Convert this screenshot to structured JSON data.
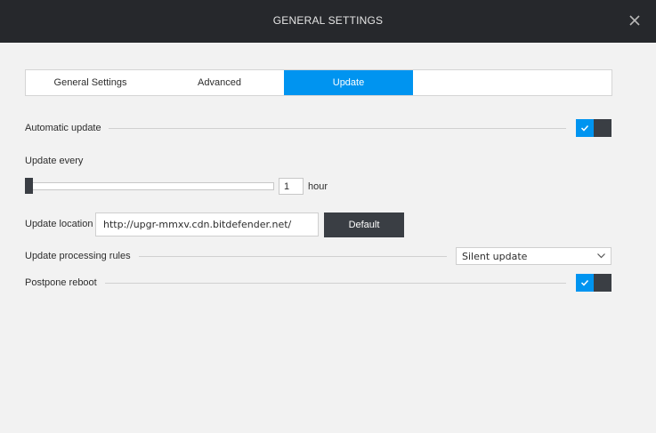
{
  "window": {
    "title": "GENERAL SETTINGS"
  },
  "tabs": [
    {
      "label": "General Settings",
      "active": false
    },
    {
      "label": "Advanced",
      "active": false
    },
    {
      "label": "Update",
      "active": true
    }
  ],
  "settings": {
    "automatic_update": {
      "label": "Automatic update",
      "enabled": true
    },
    "update_every": {
      "label": "Update every",
      "value": "1",
      "unit": "hour",
      "slider_level": 0
    },
    "update_location": {
      "label": "Update location",
      "value": "http://upgr-mmxv.cdn.bitdefender.net/",
      "default_button": "Default"
    },
    "processing_rules": {
      "label": "Update processing rules",
      "selected": "Silent update"
    },
    "postpone_reboot": {
      "label": "Postpone reboot",
      "enabled": true
    }
  },
  "colors": {
    "titlebar": "#26282c",
    "accent": "#0094f0",
    "dark": "#3a3e44",
    "background": "#f2f2f2"
  },
  "icons": {
    "close": "close-icon",
    "check": "checkmark-icon",
    "dropdown": "chevron-down-icon"
  }
}
